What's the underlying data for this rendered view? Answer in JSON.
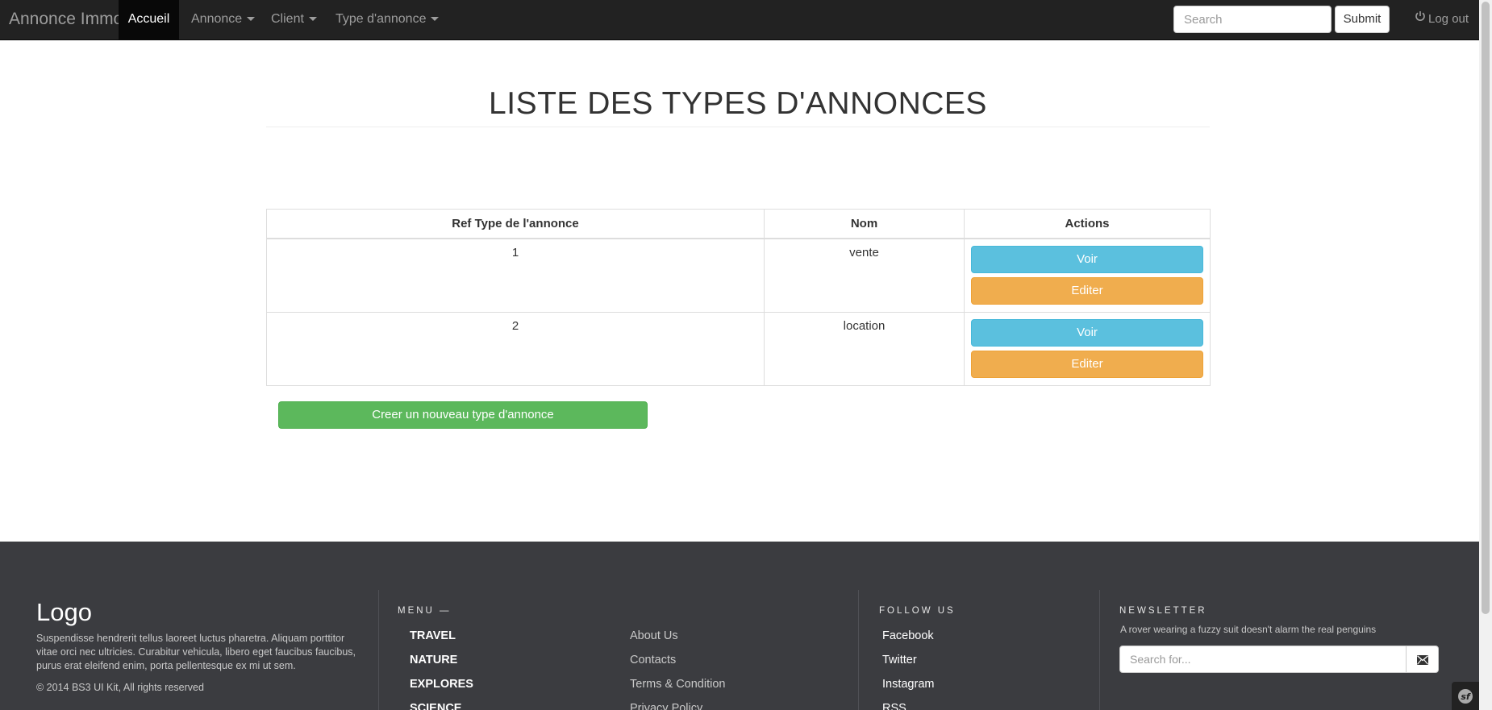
{
  "navbar": {
    "brand": "Annonce Immo",
    "items": [
      {
        "label": "Accueil"
      },
      {
        "label": "Annonce"
      },
      {
        "label": "Client"
      },
      {
        "label": "Type d'annonce"
      }
    ],
    "search_placeholder": "Search",
    "submit_label": "Submit",
    "logout_label": "Log out"
  },
  "page": {
    "title": "LISTE DES TYPES D'ANNONCES"
  },
  "table": {
    "headers": [
      "Ref Type de l'annonce",
      "Nom",
      "Actions"
    ],
    "rows": [
      {
        "ref": "1",
        "nom": "vente"
      },
      {
        "ref": "2",
        "nom": "location"
      }
    ],
    "view_label": "Voir",
    "edit_label": "Editer"
  },
  "create_button": "Creer un nouveau type d'annonce",
  "footer": {
    "logo": "Logo",
    "description": "Suspendisse hendrerit tellus laoreet luctus pharetra. Aliquam porttitor vitae orci nec ultricies. Curabitur vehicula, libero eget faucibus faucibus, purus erat eleifend enim, porta pellentesque ex mi ut sem.",
    "copyright": "© 2014 BS3 UI Kit, All rights reserved",
    "menu_heading": "MENU —",
    "menu_items": [
      "TRAVEL",
      "NATURE",
      "EXPLORES",
      "SCIENCE"
    ],
    "menu_links": [
      "About Us",
      "Contacts",
      "Terms & Condition",
      "Privacy Policy"
    ],
    "follow_heading": "FOLLOW US",
    "follow_items": [
      "Facebook",
      "Twitter",
      "Instagram",
      "RSS"
    ],
    "newsletter_heading": "NEWSLETTER",
    "newsletter_text": "A rover wearing a fuzzy suit doesn't alarm the real penguins",
    "newsletter_placeholder": "Search for..."
  },
  "colors": {
    "navbar_bg": "#222222",
    "footer_bg": "#3b3c40",
    "info": "#5bc0de",
    "warning": "#f0ad4e",
    "success": "#5cb85c"
  },
  "icons": {
    "logout": "power-icon",
    "newsletter_button": "envelope-icon",
    "debug_toolbar": "symfony-icon"
  }
}
